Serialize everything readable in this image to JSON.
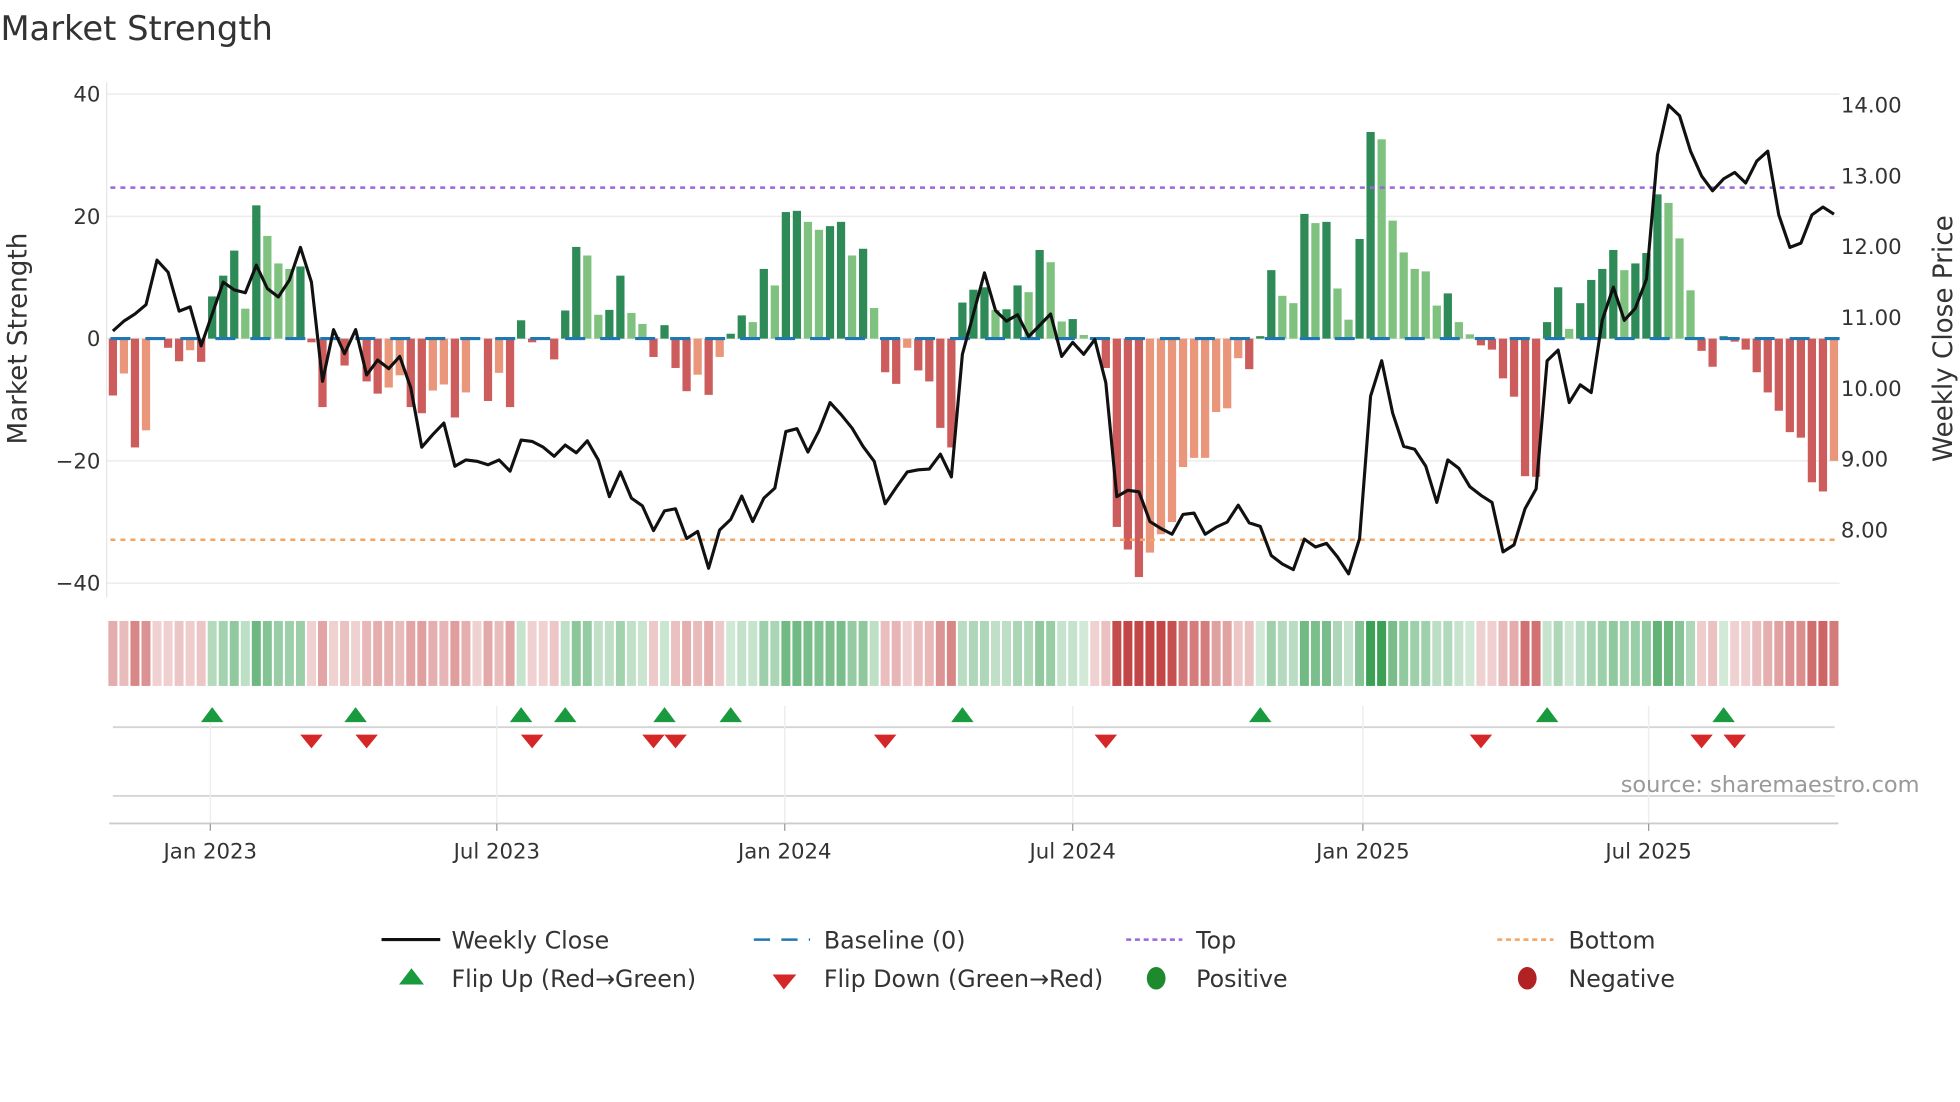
{
  "title": "Market Strength",
  "source": "source: sharemaestro.com",
  "colors": {
    "strong_green": "#2e8b57",
    "weak_green": "#7fc17f",
    "strong_red": "#cd5c5c",
    "weak_red": "#e9967a",
    "price_line": "#111111",
    "baseline": "#1f77b4",
    "top": "#9a66dd",
    "bottom": "#f4a460",
    "flip_up": "#1a9a3e",
    "flip_down": "#d62728",
    "positive": "#1e8a2e",
    "negative": "#b22222"
  },
  "legend": {
    "weekly_close": "Weekly Close",
    "baseline": "Baseline (0)",
    "top": "Top",
    "bottom": "Bottom",
    "flip_up": "Flip Up (Red→Green)",
    "flip_down": "Flip Down (Green→Red)",
    "positive": "Positive",
    "negative": "Negative"
  },
  "chart_data": {
    "type": "bar",
    "title": "Market Strength",
    "ylabel": "Market Strength",
    "y2label": "Weekly Close Price",
    "ylim": [
      -42.3,
      41.9
    ],
    "y2lim": [
      7.05,
      14.32
    ],
    "yticks": [
      "40",
      "20",
      "0",
      "−20",
      "−40"
    ],
    "ytick_values": [
      40,
      20,
      0,
      -20,
      -40
    ],
    "y2ticks": [
      "14.00",
      "13.00",
      "12.00",
      "11.00",
      "10.00",
      "9.00",
      "8.00"
    ],
    "y2tick_values": [
      14,
      13,
      12,
      11,
      10,
      9,
      8
    ],
    "xticks": [
      {
        "label": "Jan 2023",
        "week": 8.83
      },
      {
        "label": "Jul 2023",
        "week": 34.8
      },
      {
        "label": "Jan 2024",
        "week": 60.9
      },
      {
        "label": "Jul 2024",
        "week": 87.0
      },
      {
        "label": "Jan 2025",
        "week": 113.3
      },
      {
        "label": "Jul 2025",
        "week": 139.2
      }
    ],
    "top_level": 24.7,
    "bottom_level": -32.9,
    "baseline": 0,
    "strength": [
      -9.3,
      -5.7,
      -17.8,
      -15,
      0,
      -1.5,
      -3.7,
      -1.9,
      -3.8,
      6.9,
      10.3,
      14.4,
      4.9,
      21.8,
      16.8,
      12.3,
      11.4,
      11.8,
      -0.6,
      -11.2,
      0,
      -4.4,
      0,
      -7,
      -9,
      -8,
      -6,
      -11.2,
      -12.2,
      -8.5,
      -7.5,
      -12.9,
      -8.8,
      0,
      -10.2,
      -5.6,
      -11.2,
      3,
      -0.6,
      0,
      -3.4,
      4.6,
      15,
      13.6,
      3.9,
      4.7,
      10.3,
      4.2,
      2.4,
      -3,
      2.2,
      -4.8,
      -8.6,
      -5.9,
      -9.2,
      -3,
      0.8,
      3.8,
      2.7,
      11.4,
      8.7,
      20.7,
      20.9,
      19.1,
      17.8,
      18.4,
      19.1,
      13.6,
      14.7,
      5,
      -5.5,
      -7.4,
      -1.5,
      -5.2,
      -7,
      -14.6,
      -17.8,
      5.9,
      8,
      8.4,
      4.7,
      4.8,
      8.7,
      7.6,
      14.5,
      12.5,
      2.8,
      3.2,
      0.6,
      0,
      -4.8,
      -30.8,
      -34.5,
      -39,
      -35,
      -32,
      -30,
      -21,
      -19.5,
      -19.5,
      -12,
      -11.4,
      -3.2,
      -5,
      0.4,
      11.2,
      7,
      5.8,
      20.4,
      18.9,
      19.1,
      8.2,
      3.1,
      16.3,
      33.8,
      32.6,
      19.3,
      14.1,
      11.4,
      11,
      5.4,
      7.4,
      2.7,
      0.7,
      -1.1,
      -1.8,
      -6.5,
      -9.5,
      -22.5,
      -22.6,
      2.7,
      8.4,
      1.6,
      5.8,
      9.6,
      11.4,
      14.5,
      11.2,
      12.3,
      14,
      23.6,
      22.2,
      16.4,
      7.9,
      -2,
      -4.6,
      0.4,
      -0.5,
      -1.8,
      -5.5,
      -8.8,
      -11.8,
      -15.3,
      -16.2,
      -23.5,
      -25,
      -20
    ],
    "strength_shade": "DLDLDDDLDDDDLDLLLDDDDDDDDLLDDLLDLDDLDDDDDDDLLDDLLDDDDLDLDDLDLDDLLDDLDLDDLDDDDDDDLDDLDLLDLDDDDDLLLLLLLLLDDDLLDLDLLDDLLLLLLDLLDDDDDDDDLDDDDLDDDLLLDDDDDDDDDDDDL",
    "weekly_close": [
      10.81,
      10.95,
      11.05,
      11.18,
      11.81,
      11.64,
      11.09,
      11.15,
      10.6,
      11.05,
      11.5,
      11.39,
      11.35,
      11.74,
      11.41,
      11.29,
      11.53,
      11.99,
      11.5,
      10.1,
      10.83,
      10.49,
      10.83,
      10.19,
      10.4,
      10.28,
      10.45,
      10.01,
      9.17,
      9.35,
      9.51,
      8.9,
      8.99,
      8.97,
      8.92,
      8.99,
      8.83,
      9.27,
      9.25,
      9.17,
      9.04,
      9.2,
      9.09,
      9.26,
      8.99,
      8.47,
      8.82,
      8.45,
      8.34,
      7.99,
      8.27,
      8.3,
      7.88,
      7.98,
      7.46,
      8.0,
      8.15,
      8.48,
      8.12,
      8.45,
      8.59,
      9.39,
      9.43,
      9.1,
      9.4,
      9.8,
      9.63,
      9.44,
      9.18,
      8.97,
      8.37,
      8.6,
      8.82,
      8.85,
      8.86,
      9.07,
      8.75,
      10.48,
      11.05,
      11.63,
      11.1,
      10.95,
      11.04,
      10.73,
      10.89,
      11.05,
      10.45,
      10.65,
      10.48,
      10.69,
      10.08,
      8.47,
      8.56,
      8.54,
      8.12,
      8.02,
      7.94,
      8.22,
      8.24,
      7.94,
      8.04,
      8.11,
      8.35,
      8.1,
      8.05,
      7.64,
      7.52,
      7.44,
      7.87,
      7.76,
      7.81,
      7.62,
      7.38,
      7.88,
      9.89,
      10.39,
      9.65,
      9.18,
      9.14,
      8.9,
      8.39,
      8.99,
      8.87,
      8.61,
      8.49,
      8.39,
      7.69,
      7.79,
      8.3,
      8.58,
      10.39,
      10.54,
      9.8,
      10.05,
      9.94,
      10.96,
      11.43,
      10.96,
      11.13,
      11.54,
      13.3,
      14.0,
      13.85,
      13.35,
      13.0,
      12.79,
      12.96,
      13.05,
      12.9,
      13.21,
      13.35,
      12.45,
      11.99,
      12.05,
      12.45,
      12.56,
      12.46
    ],
    "flip_up_weeks": [
      9,
      22,
      37,
      41,
      50,
      56,
      77,
      104,
      130,
      146
    ],
    "flip_down_weeks": [
      18,
      23,
      38,
      49,
      51,
      70,
      90,
      124,
      144,
      147
    ],
    "legend_position": "bottom"
  }
}
